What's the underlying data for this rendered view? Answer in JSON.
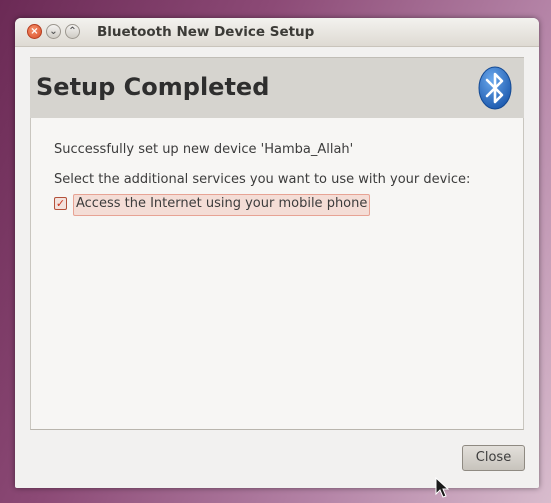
{
  "window": {
    "title": "Bluetooth New Device Setup",
    "buttons": [
      "close",
      "minimize",
      "maximize"
    ]
  },
  "header": {
    "title": "Setup Completed",
    "icon": "bluetooth-icon",
    "icon_color": "#2a6fc9"
  },
  "content": {
    "success_text": "Successfully set up new device 'Hamba_Allah'",
    "services_prompt": "Select the additional services you want to use with your device:",
    "services": [
      {
        "label": "Access the Internet using your mobile phone",
        "checked": true
      }
    ]
  },
  "footer": {
    "close_label": "Close"
  },
  "colors": {
    "close_button": "#d94f2a",
    "checkbox_accent": "#c9341d"
  }
}
